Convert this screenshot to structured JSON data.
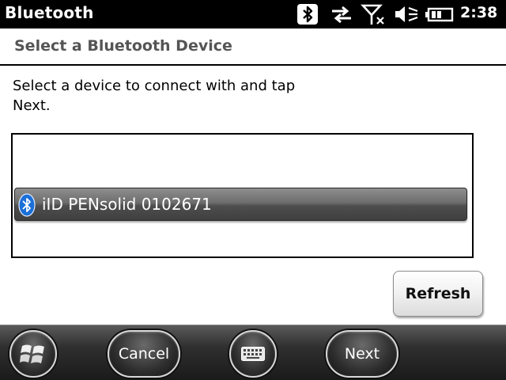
{
  "titlebar": {
    "app_title": "Bluetooth",
    "clock": "2:38",
    "icons": [
      "bluetooth-icon",
      "data-connection-icon",
      "no-signal-icon",
      "speaker-muted-icon",
      "battery-icon"
    ]
  },
  "page": {
    "title": "Select a Bluetooth Device",
    "instructions": "Select a device to connect with and tap Next."
  },
  "device_list": {
    "items": [
      {
        "label": "iID PENsolid 0102671",
        "icon": "bluetooth-icon",
        "selected": true
      }
    ]
  },
  "buttons": {
    "refresh": "Refresh"
  },
  "softkeys": {
    "start_icon": "windows-logo-icon",
    "cancel": "Cancel",
    "keyboard_icon": "keyboard-icon",
    "next": "Next"
  },
  "colors": {
    "titlebar_bg": "#000000",
    "header_text": "#555555",
    "selection_bg": "#5a5a5a"
  }
}
